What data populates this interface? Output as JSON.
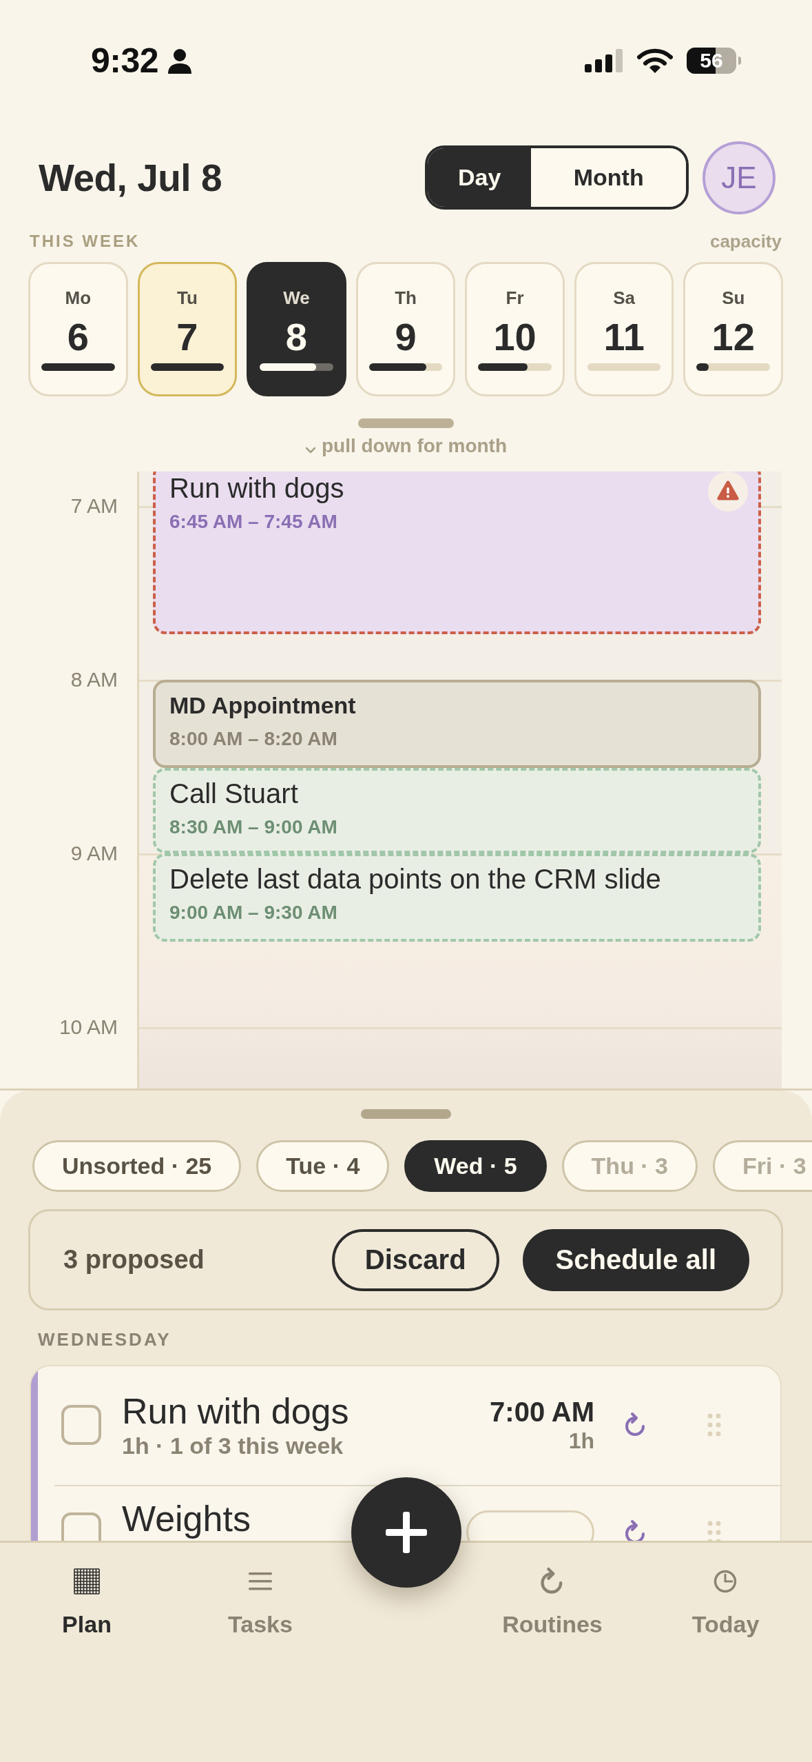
{
  "status_bar": {
    "time": "9:32",
    "battery": "56"
  },
  "header": {
    "title": "Wed, Jul 8",
    "view_modes": [
      {
        "label": "Day",
        "selected": true
      },
      {
        "label": "Month",
        "selected": false
      }
    ],
    "avatar": "JE"
  },
  "week": {
    "title": "THIS WEEK",
    "caption": "capacity",
    "days": [
      {
        "label": "Mo",
        "date": "6",
        "level": 1,
        "selected": false,
        "today": false
      },
      {
        "label": "Tu",
        "date": "7",
        "level": 1,
        "selected": false,
        "today": true
      },
      {
        "label": "We",
        "date": "8",
        "level": 0.77,
        "selected": true,
        "today": false
      },
      {
        "label": "Th",
        "date": "9",
        "level": 0.78,
        "selected": false,
        "today": false
      },
      {
        "label": "Fr",
        "date": "10",
        "level": 0.67,
        "selected": false,
        "today": false
      },
      {
        "label": "Sa",
        "date": "11",
        "level": 0,
        "selected": false,
        "today": false
      },
      {
        "label": "Su",
        "date": "12",
        "level": 0.16,
        "selected": false,
        "today": false
      }
    ],
    "hint": "pull down for month"
  },
  "timeline": {
    "hours": [
      "7 AM",
      "8 AM",
      "9 AM",
      "10 AM"
    ],
    "events": [
      {
        "title": "Run with dogs",
        "time": "6:45 AM – 7:45 AM",
        "kind": "routine",
        "proposed": true,
        "conflict": true
      },
      {
        "title": "MD Appointment",
        "time": "8:00 AM – 8:20 AM",
        "kind": "appointment",
        "proposed": false,
        "conflict": false
      },
      {
        "title": "Call Stuart",
        "time": "8:30 AM – 9:00 AM",
        "kind": "task",
        "proposed": true,
        "conflict": false
      },
      {
        "title": "Delete last data points on the CRM slide",
        "time": "9:00 AM – 9:30 AM",
        "kind": "task",
        "proposed": true,
        "conflict": false
      }
    ]
  },
  "sheet": {
    "filters": [
      {
        "label": "Unsorted · 25",
        "selected": false,
        "dimmed": false
      },
      {
        "label": "Tue · 4",
        "selected": false,
        "dimmed": false
      },
      {
        "label": "Wed · 5",
        "selected": true,
        "dimmed": false
      },
      {
        "label": "Thu · 3",
        "selected": false,
        "dimmed": true
      },
      {
        "label": "Fri · 3",
        "selected": false,
        "dimmed": true
      }
    ],
    "proposals": {
      "count": "3 proposed",
      "actions": [
        {
          "label": "Discard",
          "kind": "secondary"
        },
        {
          "label": "Schedule all",
          "kind": "primary"
        }
      ]
    },
    "section": "WEDNESDAY",
    "tasks": [
      {
        "title": "Run with dogs",
        "subtitle": "1h · 1 of 3 this week",
        "time": "7:00 AM",
        "duration": "1h",
        "kind": "scheduled",
        "checked": false,
        "recurring": true,
        "color": "#b19ed0"
      },
      {
        "title": "Weights",
        "kind": "unscheduled",
        "checked": false,
        "recurring": true,
        "color": "#b19ed0"
      }
    ]
  },
  "tab_bar": {
    "tabs": [
      {
        "label": "Plan",
        "selected": true
      },
      {
        "label": "Tasks",
        "selected": false
      },
      {
        "label": "Routines",
        "selected": false
      },
      {
        "label": "Today",
        "selected": false
      }
    ]
  }
}
